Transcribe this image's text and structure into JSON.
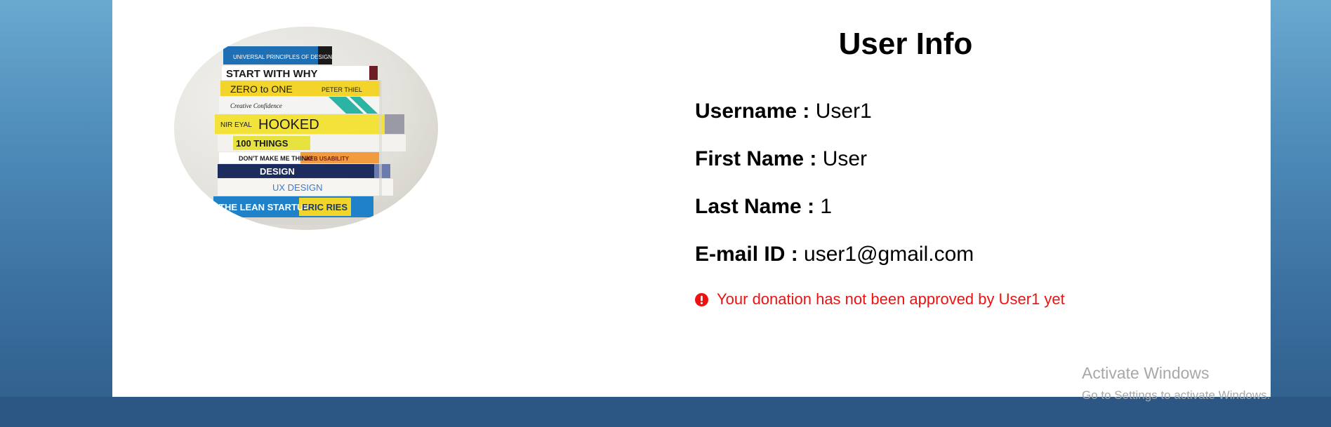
{
  "profile": {
    "title": "User Info",
    "fields": [
      {
        "label": "Username :",
        "value": "User1"
      },
      {
        "label": "First Name :",
        "value": "User"
      },
      {
        "label": "Last Name :",
        "value": "1"
      },
      {
        "label": "E-mail ID :",
        "value": "user1@gmail.com"
      }
    ],
    "alert": {
      "icon": "exclamation-circle-icon",
      "text": "Your donation has not been approved by User1 yet",
      "color": "#ee1111"
    }
  },
  "book_spines": [
    "UNIVERSAL PRINCIPLES OF DESIGN",
    "START WITH WHY",
    "ZERO to ONE",
    "PETER THIEL",
    "Creative Confidence",
    "NIR EYAL",
    "HOOKED",
    "100 THINGS",
    "DON'T MAKE ME THINK!",
    "WEB USABILITY",
    "DESIGN",
    "UX DESIGN",
    "THE LEAN STARTUP",
    "ERIC RIES"
  ],
  "watermark": {
    "title": "Activate Windows",
    "subtitle": "Go to Settings to activate Windows."
  }
}
